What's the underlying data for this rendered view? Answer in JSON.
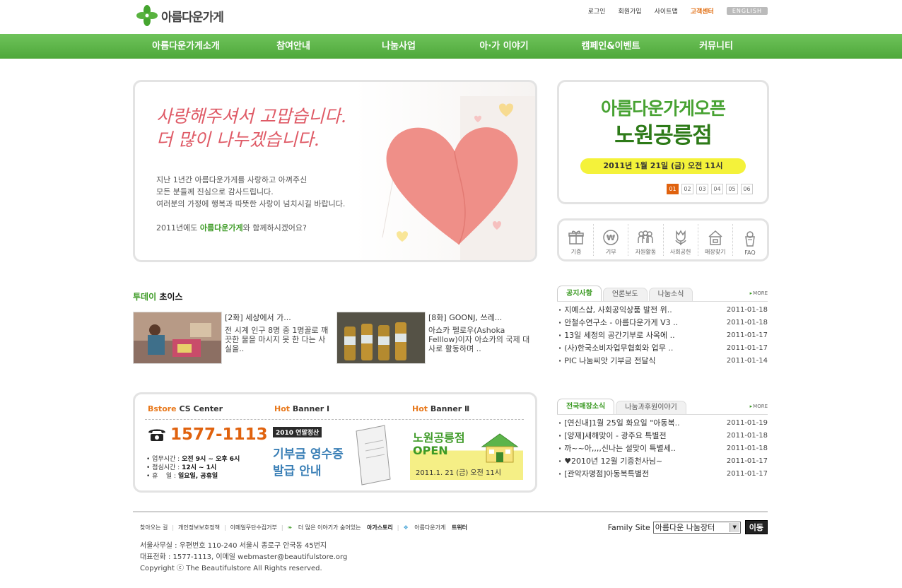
{
  "header": {
    "logo_text": "아름다운가게",
    "top_links": [
      "로그인",
      "회원가입",
      "사이트맵",
      "고객센터"
    ],
    "english_label": "ENGLISH"
  },
  "nav": [
    "아름다운가게소개",
    "참여안내",
    "나눔사업",
    "아·가 이야기",
    "캠페인&이벤트",
    "커뮤니티"
  ],
  "main_banner": {
    "headline1": "사랑해주셔서 고맙습니다.",
    "headline2": "더 많이 나누겠습니다.",
    "body1": "지난 1년간 아름다운가게를 사랑하고 아껴주신",
    "body2": "모든 분들께 진심으로 감사드립니다.",
    "body3": "여러분의 가정에 행복과 따뜻한 사랑이 넘치시길 바랍니다.",
    "foot_pre": "2011년에도 ",
    "foot_brand": "아름다운가게",
    "foot_post": "와 함께하시겠어요?"
  },
  "open_banner": {
    "line1": "아름다운가게오픈",
    "line2": "노원공릉점",
    "date": "2011년 1월 21일 (금) 오전 11시",
    "pages": [
      "01",
      "02",
      "03",
      "04",
      "05",
      "06"
    ],
    "active_page": "01"
  },
  "quick_menu": [
    {
      "label": "기증",
      "icon": "gift-icon"
    },
    {
      "label": "기부",
      "icon": "won-icon"
    },
    {
      "label": "자원활동",
      "icon": "people-icon"
    },
    {
      "label": "사회공헌",
      "icon": "tulip-icon"
    },
    {
      "label": "매장찾기",
      "icon": "store-icon"
    },
    {
      "label": "FAQ",
      "icon": "faq-icon"
    }
  ],
  "today": {
    "title_green": "투데이",
    "title_black": "초이스",
    "items": [
      {
        "title": "[2화] 세상에서 가...",
        "desc": "전 시계 인구 8명 중 1명꼴로 깨끗한 물을 마시지 못 한 다는 사실을.."
      },
      {
        "title": "[8화] GOONJ, 쓰레...",
        "desc": "아쇼카 펠로우(Ashoka Felllow)이자 아쇼카의 국제 대사로 활동하며 .."
      }
    ]
  },
  "cs": {
    "head_brand": "Bstore",
    "head_title": "CS Center",
    "phone": "1577-1113",
    "info": [
      {
        "label": "업무시간",
        "value": "오전 9시 ~ 오후 6시"
      },
      {
        "label": "점심시간",
        "value": "12시 ~ 1시"
      },
      {
        "label": "휴    일",
        "value": "일요일, 공휴일"
      }
    ],
    "hot1_head_hot": "Hot",
    "hot1_head": "Banner Ⅰ",
    "hot1_tag": "2010 연말정산",
    "hot1_line1": "기부금 영수증",
    "hot1_line2": "발급 안내",
    "hot2_head_hot": "Hot",
    "hot2_head": "Banner Ⅱ",
    "hot2_line1": "노원공릉점",
    "hot2_line2": "OPEN",
    "hot2_line3": "2011.1. 21 (금) 오전 11시"
  },
  "notice_board": {
    "tabs": [
      "공지사항",
      "언론보도",
      "나눔소식"
    ],
    "more": "MORE",
    "rows": [
      {
        "title": "지예스샵, 사회공익상품 발전 위..",
        "date": "2011-01-18"
      },
      {
        "title": "안철수연구소 - 아름다운가게 V3 ..",
        "date": "2011-01-18"
      },
      {
        "title": "13일 세정의 공간기부로 사옥에 ..",
        "date": "2011-01-17"
      },
      {
        "title": "(사)한국소비자업무협회와 업무 ..",
        "date": "2011-01-17"
      },
      {
        "title": "PIC 나눔씨앗 기부금 전달식",
        "date": "2011-01-14"
      }
    ]
  },
  "store_board": {
    "tabs": [
      "전국매장소식",
      "나눔과후원이야기"
    ],
    "more": "MORE",
    "rows": [
      {
        "title": "[연신내]1월 25일 화요일 \"아동복..",
        "date": "2011-01-19"
      },
      {
        "title": "[양재]새해맞이 - 광주요 특별전",
        "date": "2011-01-18"
      },
      {
        "title": "까~~아,,,,신나는 설맞이 특별세..",
        "date": "2011-01-18"
      },
      {
        "title": "♥2010년 12월 기증천사님~",
        "date": "2011-01-17"
      },
      {
        "title": "[관악자명점]아동복특별전",
        "date": "2011-01-17"
      }
    ]
  },
  "footer": {
    "links": [
      "찾아오는 길",
      "개인정보보호정책",
      "이메일무단수집거부"
    ],
    "story_pre": "더 많은 이야기가 숨어있는",
    "story_link": "아가스토리",
    "twitter_pre": "아름다운가게",
    "twitter_link": "트위터",
    "family_label": "Family Site",
    "family_value": "아름다운 나눔장터",
    "go_label": "이동",
    "addr1": "서울사무실 : 우편번호 110-240 서울시 종로구 안국동 45번지",
    "addr2": "대표전화 : 1577-1113, 이메일 webmaster@beautifulstore.org",
    "addr3": "Copyright ⓒ The Beautifulstore All Rights reserved."
  }
}
